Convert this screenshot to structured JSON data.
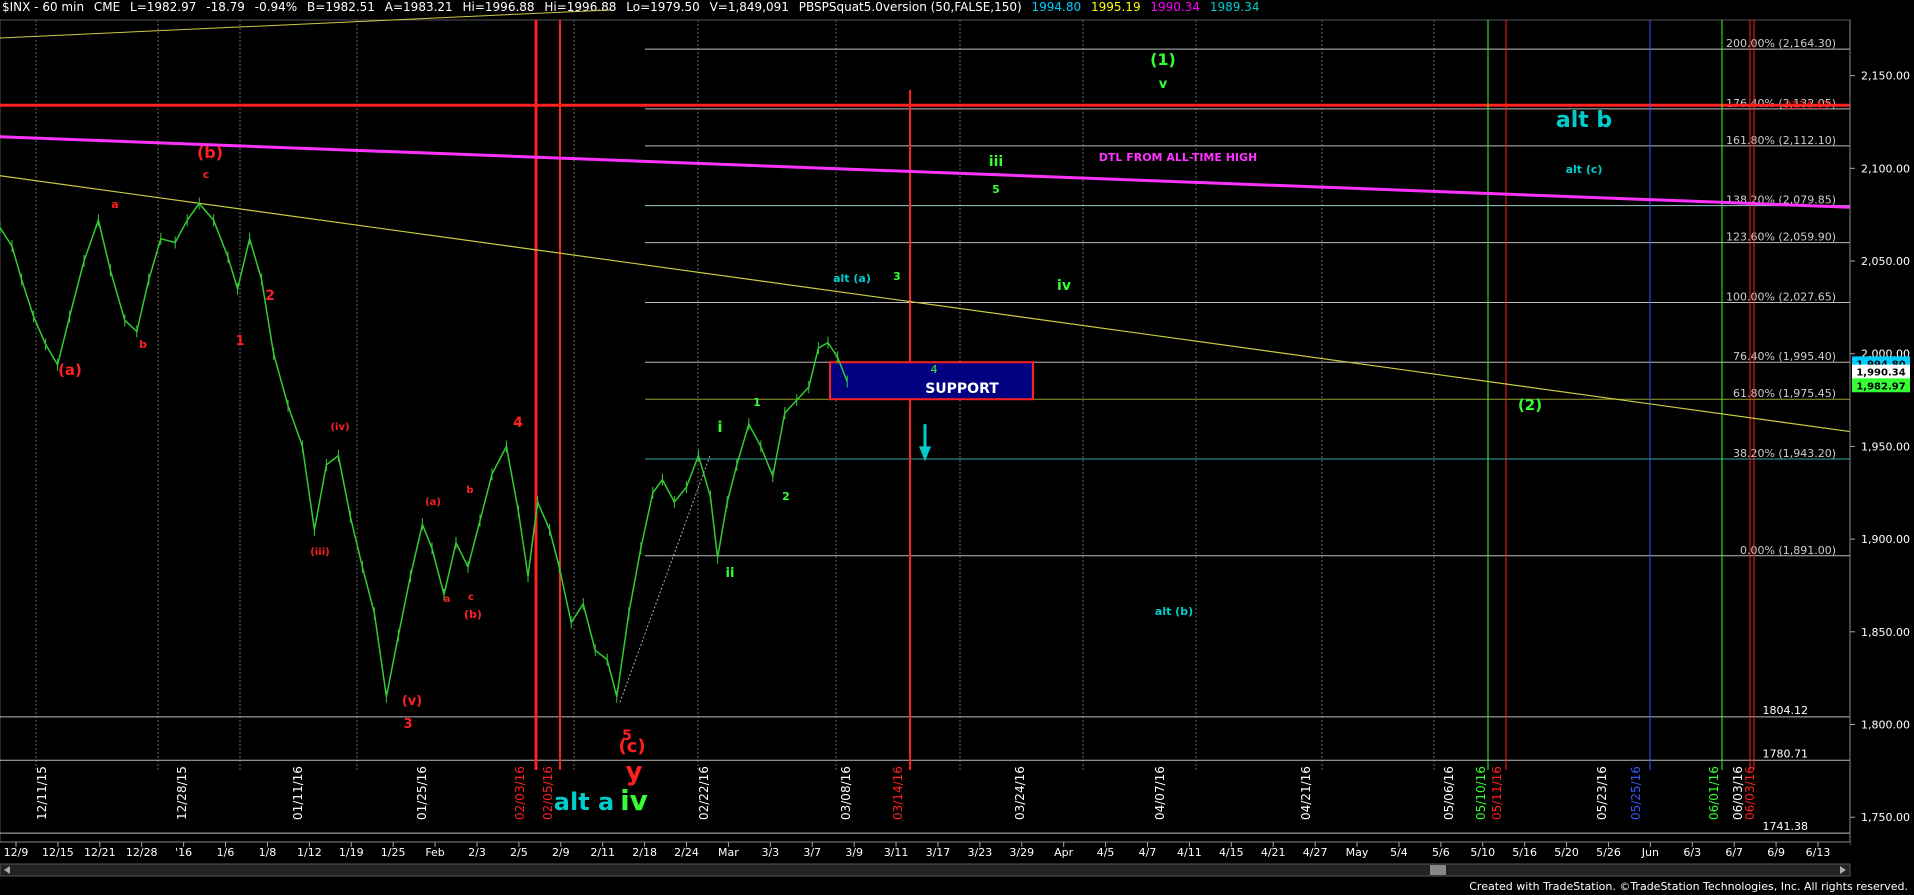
{
  "header": {
    "symbol": "$INX - 60 min",
    "exchange": "CME",
    "last": "L=1982.97",
    "change": "-18.79",
    "change_pct": "-0.94%",
    "bid": "B=1982.51",
    "ask": "A=1983.21",
    "hi": "Hi=1996.88",
    "hi2": "Hi=1996.88",
    "lo": "Lo=1979.50",
    "volume": "V=1,849,091",
    "indicator": "PBSPSquat5.0version (50,FALSE,150)",
    "ind_v1": "1994.80",
    "ind_v2": "1995.19",
    "ind_v3": "1990.34",
    "ind_v4": "1989.34",
    "ind_colors": [
      "#00ccff",
      "#ffff00",
      "#ff00ff",
      "#00cccc"
    ]
  },
  "footer": {
    "credit": "Created with TradeStation. ©TradeStation Technologies, Inc. All rights reserved."
  },
  "chart_data": {
    "type": "line",
    "symbol": "$INX",
    "interval": "60 min",
    "ylim": [
      1735,
      2180
    ],
    "y_ticks": [
      1750,
      1800,
      1850,
      1900,
      1950,
      2000,
      2050,
      2100,
      2150
    ],
    "y_tick_labels": [
      "1,750.00",
      "1,800.00",
      "1,850.00",
      "1,900.00",
      "1,950.00",
      "2,000.00",
      "2,050.00",
      "2,100.00",
      "2,150.00"
    ],
    "x_tick_labels": [
      "12/9",
      "12/15",
      "12/21",
      "12/28",
      "'16",
      "1/6",
      "1/8",
      "1/12",
      "1/19",
      "1/25",
      "Feb",
      "2/3",
      "2/5",
      "2/9",
      "2/11",
      "2/18",
      "2/24",
      "Mar",
      "3/3",
      "3/7",
      "3/9",
      "3/11",
      "3/17",
      "3/23",
      "3/29",
      "Apr",
      "4/5",
      "4/7",
      "4/11",
      "4/15",
      "4/21",
      "4/27",
      "May",
      "5/4",
      "5/6",
      "5/10",
      "5/16",
      "5/20",
      "5/26",
      "Jun",
      "6/3",
      "6/7",
      "6/9",
      "6/13"
    ],
    "price_path": [
      [
        0,
        2068
      ],
      [
        10,
        2058
      ],
      [
        18,
        2040
      ],
      [
        28,
        2020
      ],
      [
        38,
        2005
      ],
      [
        48,
        1994
      ],
      [
        58,
        2020
      ],
      [
        70,
        2050
      ],
      [
        82,
        2072
      ],
      [
        92,
        2045
      ],
      [
        104,
        2018
      ],
      [
        114,
        2012
      ],
      [
        124,
        2040
      ],
      [
        134,
        2062
      ],
      [
        146,
        2060
      ],
      [
        156,
        2072
      ],
      [
        166,
        2081
      ],
      [
        178,
        2072
      ],
      [
        190,
        2052
      ],
      [
        198,
        2035
      ],
      [
        208,
        2062
      ],
      [
        218,
        2040
      ],
      [
        228,
        2000
      ],
      [
        240,
        1972
      ],
      [
        252,
        1950
      ],
      [
        262,
        1905
      ],
      [
        272,
        1940
      ],
      [
        282,
        1945
      ],
      [
        292,
        1912
      ],
      [
        302,
        1885
      ],
      [
        312,
        1860
      ],
      [
        322,
        1815
      ],
      [
        332,
        1848
      ],
      [
        342,
        1880
      ],
      [
        352,
        1908
      ],
      [
        360,
        1895
      ],
      [
        370,
        1870
      ],
      [
        380,
        1898
      ],
      [
        390,
        1885
      ],
      [
        400,
        1910
      ],
      [
        410,
        1935
      ],
      [
        422,
        1950
      ],
      [
        432,
        1915
      ],
      [
        440,
        1880
      ],
      [
        448,
        1920
      ],
      [
        458,
        1905
      ],
      [
        466,
        1885
      ],
      [
        476,
        1855
      ],
      [
        486,
        1865
      ],
      [
        496,
        1840
      ],
      [
        506,
        1835
      ],
      [
        514,
        1815
      ],
      [
        524,
        1860
      ],
      [
        534,
        1895
      ],
      [
        544,
        1925
      ],
      [
        552,
        1932
      ],
      [
        562,
        1920
      ],
      [
        572,
        1928
      ],
      [
        582,
        1945
      ],
      [
        592,
        1923
      ],
      [
        598,
        1890
      ],
      [
        606,
        1920
      ],
      [
        614,
        1940
      ],
      [
        624,
        1962
      ],
      [
        634,
        1950
      ],
      [
        644,
        1934
      ],
      [
        654,
        1968
      ],
      [
        664,
        1975
      ],
      [
        674,
        1982
      ],
      [
        682,
        2003
      ],
      [
        690,
        2006
      ],
      [
        698,
        1998
      ],
      [
        706,
        1985
      ]
    ],
    "fib_levels": [
      {
        "label": "200.00% (2,164.30)",
        "value": 2164.3
      },
      {
        "label": "176.40% (2,132.05)",
        "value": 2132.05
      },
      {
        "label": "161.80% (2,112.10)",
        "value": 2112.1
      },
      {
        "label": "138.20% (2,079.85)",
        "value": 2079.85
      },
      {
        "label": "123.60% (2,059.90)",
        "value": 2059.9
      },
      {
        "label": "100.00% (2,027.65)",
        "value": 2027.65
      },
      {
        "label": "76.40% (1,995.40)",
        "value": 1995.4
      },
      {
        "label": "61.80% (1,975.45)",
        "value": 1975.45
      },
      {
        "label": "38.20% (1,943.20)",
        "value": 1943.2
      },
      {
        "label": "0.00% (1,891.00)",
        "value": 1891.0
      }
    ],
    "price_tags": [
      {
        "value": 1804.12,
        "label": "1804.12"
      },
      {
        "value": 1780.71,
        "label": "1780.71"
      },
      {
        "value": 1741.38,
        "label": "1741.38"
      },
      {
        "value": 2134.17,
        "label": "2134.17"
      }
    ],
    "current_tags": [
      {
        "value": 1994.8,
        "label": "1,994.80",
        "color": "#00ccff"
      },
      {
        "value": 1990.34,
        "label": "1,990.34",
        "color": "#ffffff"
      },
      {
        "value": 1982.97,
        "label": "1,982.97",
        "color": "#33ff33"
      }
    ],
    "support_zone": {
      "label": "SUPPORT",
      "low": 1975.45,
      "high": 1995.4,
      "inner_label": "4"
    },
    "annotations": [
      {
        "text": "(b)",
        "color": "#ff2020",
        "size": 16
      },
      {
        "text": "c",
        "color": "#ff2020",
        "size": 11
      },
      {
        "text": "a",
        "color": "#ff2020",
        "size": 11
      },
      {
        "text": "b",
        "color": "#ff2020",
        "size": 11
      },
      {
        "text": "(a)",
        "color": "#ff2020",
        "size": 15
      },
      {
        "text": "2",
        "color": "#ff2020",
        "size": 14
      },
      {
        "text": "1",
        "color": "#ff2020",
        "size": 13
      },
      {
        "text": "(iv)",
        "color": "#ff2020",
        "size": 10
      },
      {
        "text": "(iii)",
        "color": "#ff2020",
        "size": 10
      },
      {
        "text": "(v)",
        "color": "#ff2020",
        "size": 13
      },
      {
        "text": "3",
        "color": "#ff2020",
        "size": 13
      },
      {
        "text": "(a)",
        "color": "#ff2020",
        "size": 10
      },
      {
        "text": "b",
        "color": "#ff2020",
        "size": 10
      },
      {
        "text": "c",
        "color": "#ff2020",
        "size": 10
      },
      {
        "text": "a",
        "color": "#ff2020",
        "size": 10
      },
      {
        "text": "(b)",
        "color": "#ff2020",
        "size": 11
      },
      {
        "text": "4",
        "color": "#ff2020",
        "size": 14
      },
      {
        "text": "5",
        "color": "#ff2020",
        "size": 14
      },
      {
        "text": "(c)",
        "color": "#ff2020",
        "size": 18
      },
      {
        "text": "y",
        "color": "#ff2020",
        "size": 26
      },
      {
        "text": "iv",
        "color": "#33ff33",
        "size": 28
      },
      {
        "text": "alt a",
        "color": "#00cccc",
        "size": 24
      },
      {
        "text": "i",
        "color": "#33ff33",
        "size": 15
      },
      {
        "text": "ii",
        "color": "#33ff33",
        "size": 13
      },
      {
        "text": "1",
        "color": "#33ff33",
        "size": 11
      },
      {
        "text": "2",
        "color": "#33ff33",
        "size": 11
      },
      {
        "text": "iii",
        "color": "#33ff33",
        "size": 14
      },
      {
        "text": "5",
        "color": "#33ff33",
        "size": 11
      },
      {
        "text": "3",
        "color": "#33ff33",
        "size": 11
      },
      {
        "text": "iv",
        "color": "#33ff33",
        "size": 14
      },
      {
        "text": "(1)",
        "color": "#33ff33",
        "size": 16
      },
      {
        "text": "v",
        "color": "#33ff33",
        "size": 13
      },
      {
        "text": "(2)",
        "color": "#33ff33",
        "size": 15
      },
      {
        "text": "alt (a)",
        "color": "#00cccc",
        "size": 11
      },
      {
        "text": "alt (b)",
        "color": "#00cccc",
        "size": 11
      },
      {
        "text": "alt (c)",
        "color": "#00cccc",
        "size": 11
      },
      {
        "text": "alt b",
        "color": "#00cccc",
        "size": 22
      },
      {
        "text": "DTL FROM ALL-TIME HIGH",
        "color": "#ff33ff",
        "size": 11
      }
    ],
    "date_labels": [
      {
        "text": "12/11/15",
        "color": "#ffffff"
      },
      {
        "text": "12/28/15",
        "color": "#ffffff"
      },
      {
        "text": "01/11/16",
        "color": "#ffffff"
      },
      {
        "text": "01/25/16",
        "color": "#ffffff"
      },
      {
        "text": "02/03/16",
        "color": "#ff2020"
      },
      {
        "text": "02/05/16",
        "color": "#ff2020"
      },
      {
        "text": "02/22/16",
        "color": "#ffffff"
      },
      {
        "text": "03/08/16",
        "color": "#ffffff"
      },
      {
        "text": "03/14/16",
        "color": "#ff2020"
      },
      {
        "text": "03/24/16",
        "color": "#ffffff"
      },
      {
        "text": "04/07/16",
        "color": "#ffffff"
      },
      {
        "text": "04/21/16",
        "color": "#ffffff"
      },
      {
        "text": "05/06/16",
        "color": "#ffffff"
      },
      {
        "text": "05/10/16",
        "color": "#33ff33"
      },
      {
        "text": "05/11/16",
        "color": "#ff2020"
      },
      {
        "text": "05/23/16",
        "color": "#ffffff"
      },
      {
        "text": "05/25/16",
        "color": "#3355ff"
      },
      {
        "text": "06/01/16",
        "color": "#33ff33"
      },
      {
        "text": "06/03/16",
        "color": "#ffffff"
      },
      {
        "text": "06/03/16",
        "color": "#ff2020"
      }
    ]
  }
}
